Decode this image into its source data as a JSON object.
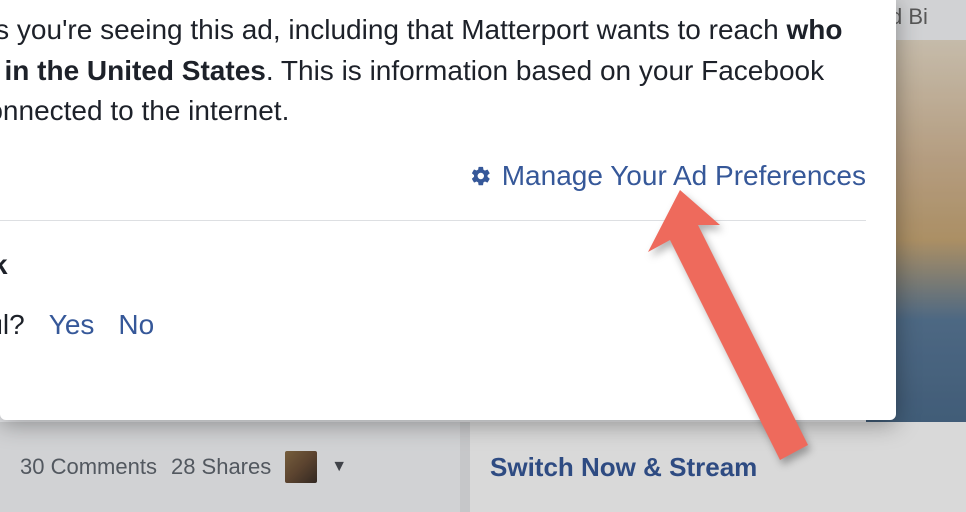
{
  "background": {
    "top_right_fragment": "d Bi",
    "comments_text": "30 Comments",
    "shares_text": "28 Shares",
    "promo_text": "Switch Now & Stream"
  },
  "popup": {
    "reason_fragment_1": "sons you're seeing this ad, including that Matterport wants to reach ",
    "reason_bold": "who live in the United States",
    "reason_fragment_2": ". This is information based on your Facebook ",
    "reason_fragment_3": "e connected to the internet.",
    "manage_link": "Manage Your Ad Preferences",
    "think_heading": "hink",
    "useful_label": "seful?",
    "yes": "Yes",
    "no": "No"
  }
}
